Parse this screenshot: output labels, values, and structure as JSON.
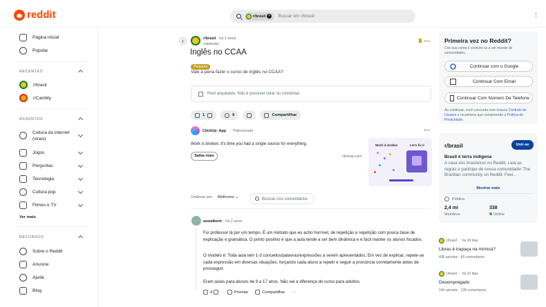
{
  "header": {
    "logo_text": "reddit",
    "search_chip": "r/brasil",
    "search_placeholder": "Buscar em r/brasil"
  },
  "sidebar": {
    "nav": [
      {
        "label": "Página inicial",
        "icon": "home-icon"
      },
      {
        "label": "Popular",
        "icon": "popular-icon"
      }
    ],
    "recent_head": "RECENTES",
    "recent": [
      {
        "label": "r/brasil"
      },
      {
        "label": "r/Cambly"
      }
    ],
    "topics_head": "ASSUNTOS",
    "topics": [
      {
        "label": "Cultura da internet",
        "label2": "(virais)",
        "icon": "smile-icon"
      },
      {
        "label": "Jogos",
        "icon": "gamepad-icon"
      },
      {
        "label": "Perguntas",
        "icon": "question-icon"
      },
      {
        "label": "Tecnologia",
        "icon": "chip-icon"
      },
      {
        "label": "Cultura pop",
        "icon": "star-icon"
      },
      {
        "label": "Filmes e TV",
        "icon": "film-icon"
      }
    ],
    "see_more": "Ver mais",
    "resources_head": "RECURSOS",
    "resources": [
      {
        "label": "Sobre o Reddit",
        "icon": "reddit-icon"
      },
      {
        "label": "Anuncie",
        "icon": "megaphone-icon"
      },
      {
        "label": "Ajuda",
        "icon": "help-icon"
      },
      {
        "label": "Blog",
        "icon": "book-icon"
      }
    ]
  },
  "post": {
    "subreddit": "r/brasil",
    "time": "há 2 anos",
    "author": "caiobuda",
    "title": "Inglês no CCAA",
    "flair": "Pergunta",
    "body": "Vale a pena fazer o curso de inglês no CCAA?",
    "archived": "Post arquivado. Não é possível votar ou comentar.",
    "votes": "1",
    "comments": "6",
    "share": "Compartilhar"
  },
  "ad": {
    "name": "ClickUp_App",
    "sponsored": "Patrocinado",
    "text": "Work is broken. It's time you had a single source for everything.",
    "button": "Saiba mais",
    "url": "clickup.com",
    "img_h1": "Work is broken",
    "img_h2": "Let's fix it"
  },
  "comments_bar": {
    "sort_label": "Ordenar por:",
    "sort_value": "Melhores",
    "search_placeholder": "Buscar nos comentários"
  },
  "comment": {
    "author": "aswalkertr",
    "time": "há 2 anos",
    "p1": "Fui professor lá por um tempo. É um método que eu acho horrível, de repetição e repetição com pouca base de explicação e gramática. O ponto positivo é que a aula tende a ser bem dinâmica e é fácil manter os alunos focados.",
    "p2": "O modelo é: Toda aula tem 1-3 conceitos/palavras/expressões a serem apresentados. Em vez de explicar, repete-se cada expressão em diversas situações, forçando cada aluno a repetir e seguir a pronúncia corretamente antes de prosseguir.",
    "p3": "Eram aulas para alunos de 9 a 17 anos. Não sei a diferença do curso para adultos.",
    "votes": "4",
    "award": "Premiar",
    "share": "Compartilhar"
  },
  "login_panel": {
    "title": "Primeira vez no Reddit?",
    "subtitle": "Crie sua conta e conecte-se a um mundo de comunidades.",
    "google": "Continuar com o Google",
    "email": "Continuar Com Email",
    "phone": "Continuar Com Número De Telefone",
    "legal_pre": "Ao continuar, você concorda com nossos ",
    "legal_terms": "Contrato de Usuário",
    "legal_mid": " e reconhece que compreende a ",
    "legal_privacy": "Política de Privacidade",
    "legal_end": "."
  },
  "community": {
    "name": "r/brasil",
    "join": "Unir-se",
    "subtitle": "Brasil é terra indígena",
    "desc": "A casa dos brasileiros no Reddit. Leia as regras e participe de nossa comunidade! The Brazilian community on Reddit. Feel...",
    "more": "Mostrar mais",
    "visibility": "Pública",
    "members_value": "2,4 mi",
    "members_label": "Membros",
    "online_value": "338",
    "online_label": "Online"
  },
  "related": [
    {
      "sub": "r/brasil",
      "time": "há 18 dias",
      "title": "Libras é trapaça na mímica?",
      "stats": "408 upvotes · 85 comentários"
    },
    {
      "sub": "r/brasil",
      "time": "há 10 dias",
      "title": "Desempregado",
      "stats": "194 upvotes · 128 comentários"
    }
  ]
}
